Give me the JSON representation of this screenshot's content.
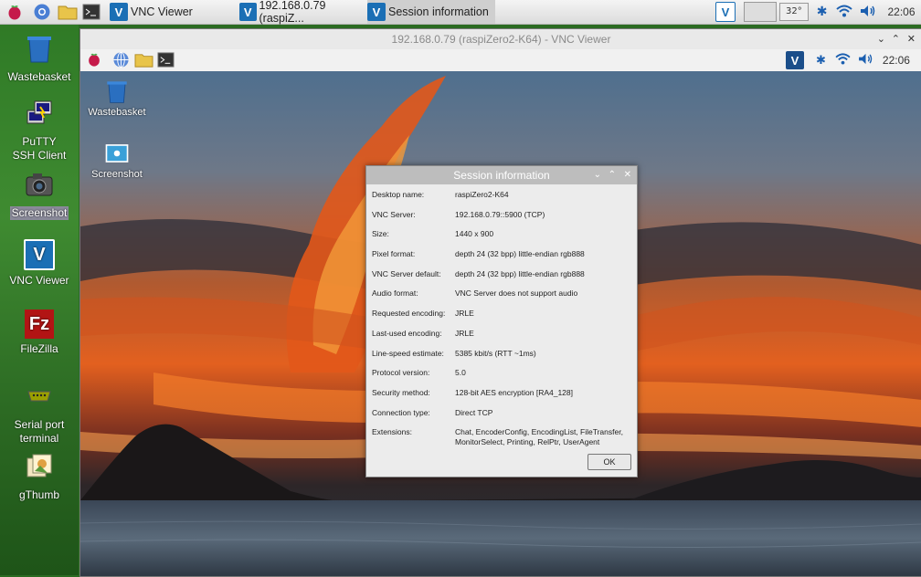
{
  "host_taskbar": {
    "tasks": [
      {
        "label": "VNC Viewer"
      },
      {
        "label": "192.168.0.79 (raspiZ..."
      },
      {
        "label": "Session information"
      }
    ],
    "temp": "32°",
    "clock": "22:06"
  },
  "host_desktop": {
    "icons": [
      {
        "label": "Wastebasket"
      },
      {
        "label": "PuTTY SSH Client"
      },
      {
        "label": "Screenshot"
      },
      {
        "label": "VNC Viewer"
      },
      {
        "label": "FileZilla"
      },
      {
        "label": "Serial port terminal"
      },
      {
        "label": "gThumb"
      }
    ]
  },
  "vnc_window": {
    "title": "192.168.0.79 (raspiZero2-K64) - VNC Viewer"
  },
  "remote": {
    "clock": "22:06",
    "desktop_icons": [
      {
        "label": "Wastebasket"
      },
      {
        "label": "Screenshot"
      }
    ]
  },
  "dialog": {
    "title": "Session information",
    "rows": [
      {
        "key": "Desktop name:",
        "value": "raspiZero2-K64"
      },
      {
        "key": "VNC Server:",
        "value": "192.168.0.79::5900 (TCP)"
      },
      {
        "key": "Size:",
        "value": "1440 x 900"
      },
      {
        "key": "Pixel format:",
        "value": "depth 24 (32 bpp) little-endian rgb888"
      },
      {
        "key": "VNC Server default:",
        "value": "depth 24 (32 bpp) little-endian rgb888"
      },
      {
        "key": "Audio format:",
        "value": "VNC Server does not support audio"
      },
      {
        "key": "Requested encoding:",
        "value": "JRLE"
      },
      {
        "key": "Last-used encoding:",
        "value": "JRLE"
      },
      {
        "key": "Line-speed estimate:",
        "value": "5385 kbit/s (RTT ~1ms)"
      },
      {
        "key": "Protocol version:",
        "value": "5.0"
      },
      {
        "key": "Security method:",
        "value": "128-bit AES encryption [RA4_128]"
      },
      {
        "key": "Connection type:",
        "value": "Direct TCP"
      },
      {
        "key": "Extensions:",
        "value": "Chat, EncoderConfig, EncodingList, FileTransfer, MonitorSelect, Printing, RelPtr, UserAgent"
      }
    ],
    "ok_label": "OK"
  }
}
